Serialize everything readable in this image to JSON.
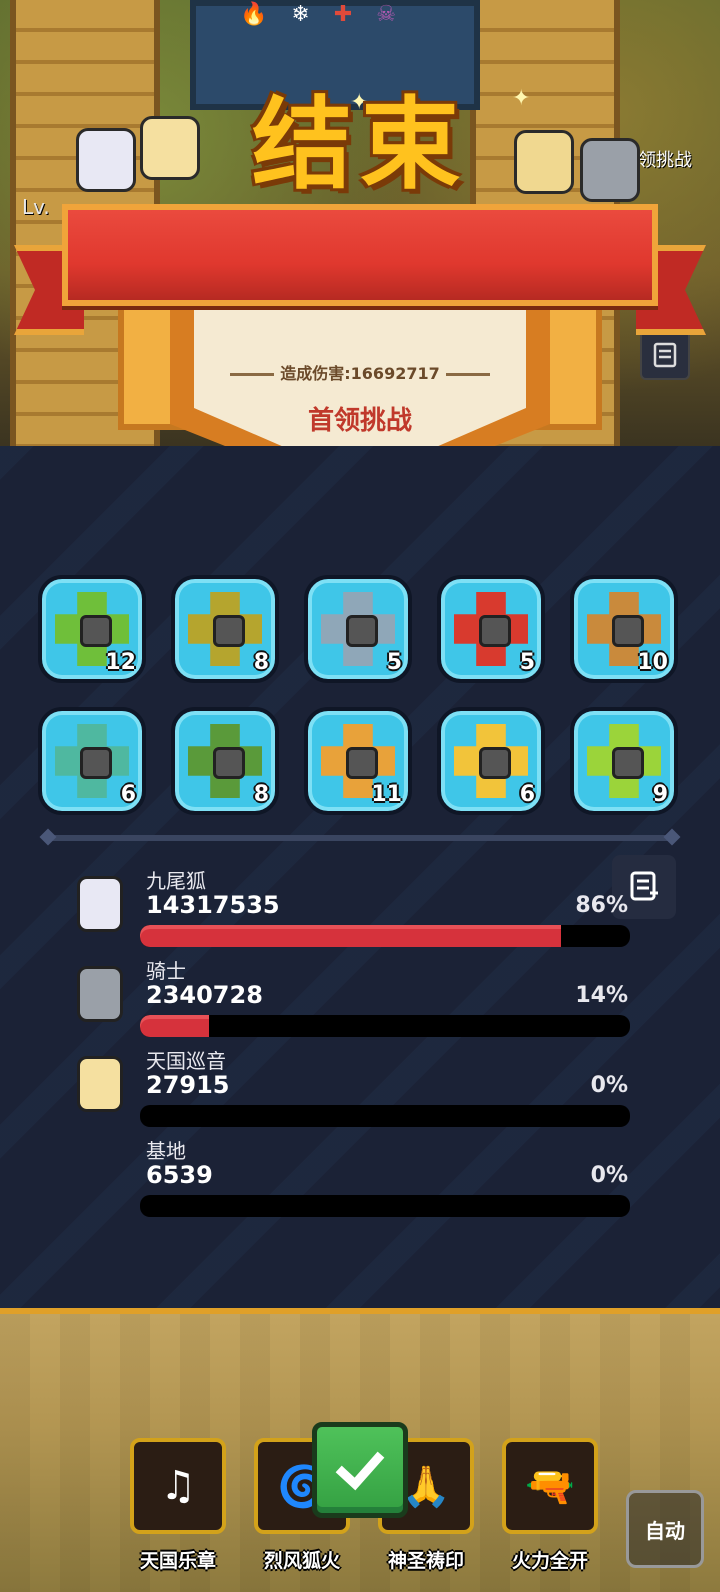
{
  "header": {
    "title": "结束",
    "level_label": "Lv.",
    "boss_label": "领挑战",
    "damage_label": "造成伤害:16692717",
    "mode_title": "首领挑战"
  },
  "heroes_grid": [
    {
      "count": "12",
      "color": "#6fbf3a"
    },
    {
      "count": "8",
      "color": "#b5a52e"
    },
    {
      "count": "5",
      "color": "#8fa7b8"
    },
    {
      "count": "5",
      "color": "#d83a2e"
    },
    {
      "count": "10",
      "color": "#c98a3c"
    },
    {
      "count": "6",
      "color": "#4fb8a0"
    },
    {
      "count": "8",
      "color": "#5a9a3a"
    },
    {
      "count": "11",
      "color": "#e8a23a"
    },
    {
      "count": "6",
      "color": "#f2c43a"
    },
    {
      "count": "9",
      "color": "#9bd43a"
    }
  ],
  "damage_rows": [
    {
      "name": "九尾狐",
      "value": "14317535",
      "percent": "86%",
      "fill": 0.86,
      "avatar": "fox-girl-icon"
    },
    {
      "name": "骑士",
      "value": "2340728",
      "percent": "14%",
      "fill": 0.14,
      "avatar": "knight-icon"
    },
    {
      "name": "天国巡音",
      "value": "27915",
      "percent": "0%",
      "fill": 0,
      "avatar": "angel-icon"
    },
    {
      "name": "基地",
      "value": "6539",
      "percent": "0%",
      "fill": 0,
      "avatar": ""
    }
  ],
  "skills": [
    {
      "label": "天国乐章",
      "icon": "harp-icon"
    },
    {
      "label": "烈风狐火",
      "icon": "tornado-icon"
    },
    {
      "label": "神圣祷印",
      "icon": "praying-hands-icon"
    },
    {
      "label": "火力全开",
      "icon": "guns-icon"
    }
  ],
  "auto_label": "自动",
  "colors": {
    "panel_bg": "#1b2236",
    "bar_fill": "#d6323c",
    "tile_border": "#3fc6e8",
    "title_gold": "#ffc21e"
  }
}
